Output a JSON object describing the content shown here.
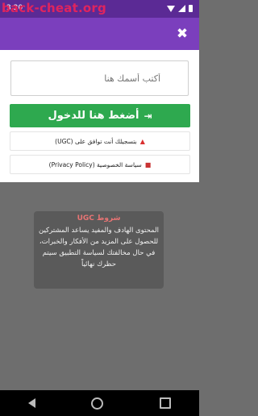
{
  "status_bar": {
    "time": "3:20",
    "watermark": "back-cheat.org"
  },
  "app_bar": {
    "close_glyph": "✖"
  },
  "form": {
    "name_placeholder": "أكتب أسمك هنا",
    "login_label": "أضغط هنا للدخول",
    "login_icon": "sign-in-icon",
    "agree_text": "بتسجيلك أنت توافق على (UGC)",
    "policy_text": "سياسة الخصوصية (Privacy Policy)"
  },
  "terms": {
    "title": "شروط UGC",
    "body": "المحتوى الهادف والمفيد يساعد المشتركين للحصول على المزيد من الأفكار والخبرات، في حال مخالفتك لسياسة التطبيق سيتم حظرك نهائياً"
  },
  "colors": {
    "status_bar": "#5b2a95",
    "app_bar": "#7b3fbd",
    "login_button": "#2ea94f",
    "warning": "#d93030",
    "overlay": "#6e6e6e"
  }
}
